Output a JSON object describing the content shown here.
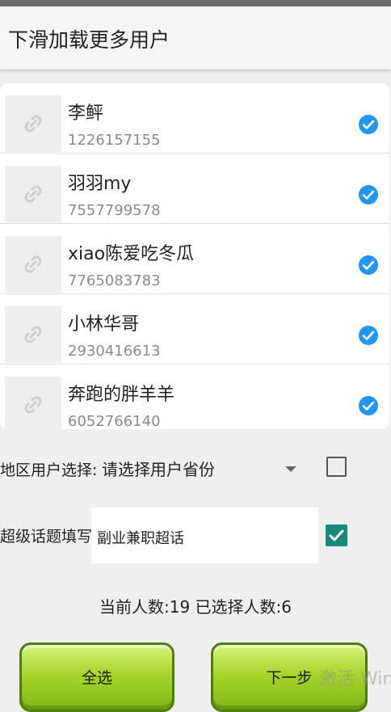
{
  "title": "下滑加载更多用户",
  "users": [
    {
      "name": "李鲆",
      "id": "1226157155",
      "checked": true
    },
    {
      "name": "羽羽my",
      "id": "7557799578",
      "checked": true
    },
    {
      "name": "xiao陈爱吃冬瓜",
      "id": "7765083783",
      "checked": true
    },
    {
      "name": "小林华哥",
      "id": "2930416613",
      "checked": true
    },
    {
      "name": "奔跑的胖羊羊",
      "id": "6052766140",
      "checked": true
    }
  ],
  "region": {
    "label": "地区用户选择:",
    "selected": "请选择用户省份",
    "checked": false
  },
  "topic": {
    "label": "超级话题填写:",
    "value": "副业兼职超话",
    "checked": true
  },
  "count_text": "当前人数:19 已选择人数:6",
  "buttons": {
    "select_all": "全选",
    "next": "下一步"
  },
  "watermark": "激活 Win",
  "colors": {
    "accent_blue": "#2196f3",
    "checkbox_teal": "#16897a",
    "button_green": "#a6d62c"
  }
}
